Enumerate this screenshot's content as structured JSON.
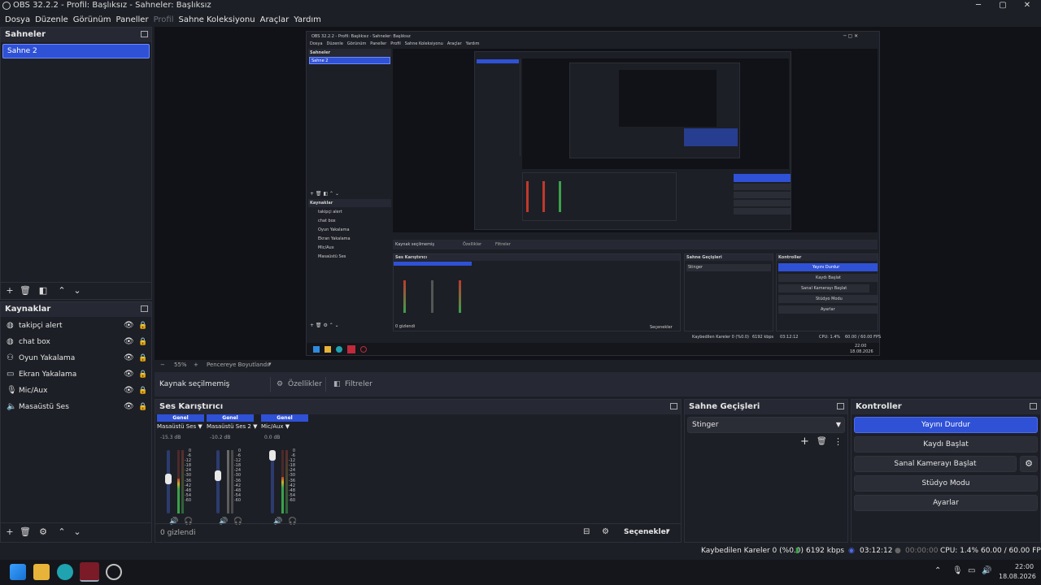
{
  "window": {
    "title": "OBS 32.2.2 - Profil: Başlıksız - Sahneler: Başlıksız",
    "controls": [
      "─",
      "▢",
      "✕"
    ]
  },
  "menu": {
    "items": [
      "Dosya",
      "Düzenle",
      "Görünüm",
      "Paneller",
      "Profil",
      "Sahne Koleksiyonu",
      "Araçlar",
      "Yardım"
    ]
  },
  "scenes": {
    "header": "Sahneler",
    "items": [
      "Sahne 2"
    ]
  },
  "sources": {
    "header": "Kaynaklar",
    "items": [
      {
        "label": "takipçi alert",
        "icon": "globe-icon"
      },
      {
        "label": "chat box",
        "icon": "globe-icon"
      },
      {
        "label": "Oyun Yakalama",
        "icon": "gamepad-icon"
      },
      {
        "label": "Ekran Yakalama",
        "icon": "monitor-icon"
      },
      {
        "label": "Mic/Aux",
        "icon": "microphone-icon"
      },
      {
        "label": "Masaüstü Ses",
        "icon": "speaker-icon"
      }
    ]
  },
  "preview_bar": {
    "zoom": "55%",
    "mode": "Pencereye Boyutlandır"
  },
  "properties_bar": {
    "no_source": "Kaynak seçilmemiş",
    "properties": "Özellikler",
    "filters": "Filtreler"
  },
  "mixer": {
    "header": "Ses Karıştırıcı",
    "channels": [
      {
        "tag": "Genel",
        "name": "Masaüstü Ses",
        "db": "-15.3 dB",
        "level": 0.55,
        "fader": 0.55
      },
      {
        "tag": "Genel",
        "name": "Masaüstü Ses 2",
        "db": "-10.2 dB",
        "level": 0.0,
        "fader": 0.62
      },
      {
        "tag": "Genel",
        "name": "Mic/Aux",
        "db": "0.0 dB",
        "level": 0.58,
        "fader": 1.0
      }
    ],
    "scale": [
      "0",
      "-6",
      "-12",
      "-18",
      "-24",
      "-30",
      "-36",
      "-42",
      "-48",
      "-54",
      "-60"
    ],
    "hidden": "0 gizlendi",
    "options": "Seçenekler"
  },
  "transitions": {
    "header": "Sahne Geçişleri",
    "selected": "Stinger"
  },
  "controls": {
    "header": "Kontroller",
    "stop_stream": "Yayını Durdur",
    "start_record": "Kaydı Başlat",
    "start_virtualcam": "Sanal Kamerayı Başlat",
    "studio_mode": "Stüdyo Modu",
    "settings": "Ayarlar"
  },
  "status": {
    "dropped": "Kaybedilen Kareler 0 (%0.0)",
    "bitrate": "6192 kbps",
    "stream_time": "03:12:12",
    "record_time": "00:00:00",
    "cpu": "CPU: 1.4%",
    "fps": "60.00 / 60.00 FPS"
  },
  "taskbar": {
    "time": "22:00",
    "date": "18.08.2026"
  },
  "nested": {
    "title": "OBS 32.2.2 - Profil: Başlıksız - Sahneler: Başlıksız",
    "menu": [
      "Dosya",
      "Düzenle",
      "Görünüm",
      "Paneller",
      "Profil",
      "Sahne Koleksiyonu",
      "Araçlar",
      "Yardım"
    ],
    "scenes_header": "Sahneler",
    "scene": "Sahne 2",
    "sources_header": "Kaynaklar",
    "sources": [
      "takipçi alert",
      "chat box",
      "Oyun Yakalama",
      "Ekran Yakalama",
      "Mic/Aux",
      "Masaüstü Ses"
    ],
    "no_source": "Kaynak seçilmemiş",
    "properties": "Özellikler",
    "filters": "Filtreler",
    "mixer_header": "Ses Karıştırıcı",
    "transitions_header": "Sahne Geçişleri",
    "stinger": "Stinger",
    "controls_header": "Kontroller",
    "stop_stream": "Yayını Durdur",
    "start_record": "Kaydı Başlat",
    "start_virtualcam": "Sanal Kamerayı Başlat",
    "studio_mode": "Stüdyo Modu",
    "settings": "Ayarlar",
    "hidden": "0 gizlendi",
    "options": "Seçenekler",
    "dropped": "Kaybedilen Kareler 0 (%0.0)",
    "bitrate": "6192 kbps",
    "stream_time": "03:12:12",
    "cpu": "CPU: 1.4%",
    "fps": "60.00 / 60.00 FPS",
    "time": "22:00",
    "date": "18.08.2026"
  }
}
